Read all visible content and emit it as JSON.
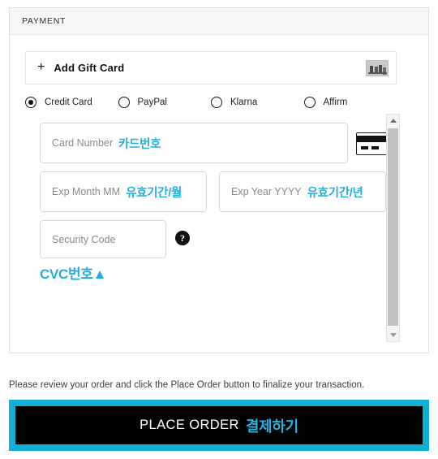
{
  "payment": {
    "header_title": "PAYMENT",
    "giftcard": {
      "plus": "+",
      "label": "Add Gift Card",
      "thumb_icon": "gift-card-thumbnail-icon"
    },
    "methods": [
      {
        "label": "Credit Card",
        "selected": true
      },
      {
        "label": "PayPal",
        "selected": false
      },
      {
        "label": "Klarna",
        "selected": false
      },
      {
        "label": "Affirm",
        "selected": false
      }
    ],
    "fields": {
      "card_number": {
        "placeholder": "Card Number",
        "annotation": "카드번호",
        "value": ""
      },
      "exp_month": {
        "placeholder": "Exp Month MM",
        "annotation": "유효기간/월",
        "value": ""
      },
      "exp_year": {
        "placeholder": "Exp Year YYYY",
        "annotation": "유효기간/년",
        "value": ""
      },
      "security_code": {
        "placeholder": "Security Code",
        "annotation": "CVC번호▲",
        "value": ""
      }
    },
    "card_brand_icon": "credit-card-icon",
    "help_icon": "question-mark-icon",
    "help_glyph": "?",
    "scrollbar": {
      "up_icon": "chevron-up-icon",
      "down_icon": "chevron-down-icon"
    }
  },
  "review_note": "Please review your order and click the Place Order button to finalize your transaction.",
  "place_order": {
    "label_en": "PLACE ORDER",
    "label_kr": "결제하기"
  },
  "colors": {
    "accent_cyan": "#22b0e0",
    "button_border": "#0fafd8",
    "button_bg": "#000000",
    "header_bg": "#f7f7f8"
  }
}
